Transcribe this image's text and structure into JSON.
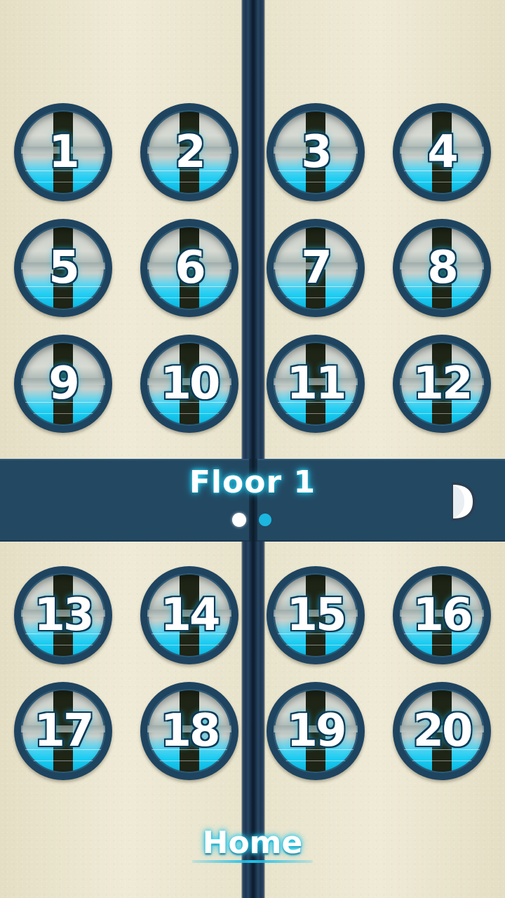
{
  "header": {
    "floor_title": "Floor 1"
  },
  "pagination": {
    "pages": 2,
    "current_page": 1
  },
  "levels": [
    "1",
    "2",
    "3",
    "4",
    "5",
    "6",
    "7",
    "8",
    "9",
    "10",
    "11",
    "12",
    "13",
    "14",
    "15",
    "16",
    "17",
    "18",
    "19",
    "20"
  ],
  "footer": {
    "home_label": "Home"
  },
  "colors": {
    "accent": "#22c1e8",
    "bar": "#234862",
    "door": "#1f4460",
    "background": "#ece7d3"
  },
  "icons": {
    "next_page": "half-moon-arrow-icon"
  }
}
